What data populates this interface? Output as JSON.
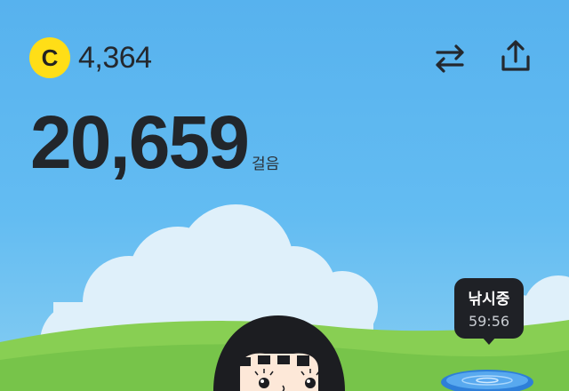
{
  "header": {
    "coin": {
      "icon": "coin-icon",
      "symbol": "C",
      "balance": "4,364",
      "color": "#ffde17"
    },
    "actions": [
      {
        "name": "swap-arrows-icon"
      },
      {
        "name": "share-icon"
      }
    ]
  },
  "steps": {
    "count": "20,659",
    "unit": "걸음"
  },
  "activity": {
    "status": "낚시중",
    "timer": "59:56"
  },
  "colors": {
    "sky": "#5cb6f0",
    "grass": "#7dc94a",
    "text": "#22262b",
    "bubble": "#1f2126"
  }
}
